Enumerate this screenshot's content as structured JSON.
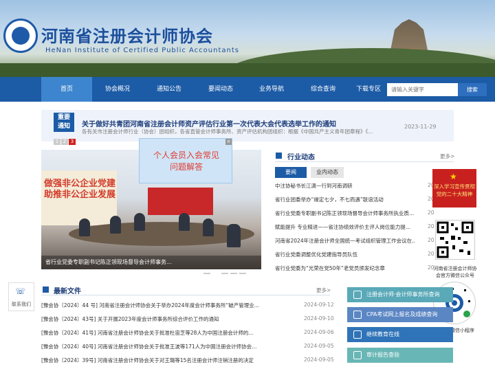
{
  "header": {
    "title": "河南省注册会计师协会",
    "subtitle": "HeNan Institute of Certified Public Accountants"
  },
  "nav": {
    "items": [
      "首页",
      "协会概况",
      "通知公告",
      "要闻动态",
      "业务导航",
      "综合查询",
      "下载专区"
    ],
    "active_index": 0,
    "search_placeholder": "请输入关键字",
    "search_button": "搜索"
  },
  "notice": {
    "badge_line1": "重要",
    "badge_line2": "通知",
    "pages": [
      "1",
      "2",
      "3"
    ],
    "active_page": "3",
    "title": "关于做好共青团河南省注册会计师资产评估行业第一次代表大会代表选举工作的通知",
    "summary": "各有关市注册会计师行业（协会）团组织，各省直管会计师事务所、资产评估机构团组织：根据《中国共产主义青年团章程》《...",
    "date": "2023-11-29"
  },
  "slideshow": {
    "caption": "省行业党委专职副书记陈正领现场督导会计师事务...",
    "wall_text_line1": "做强非公企业党建",
    "wall_text_line2": "助推非公企业发展"
  },
  "popup": {
    "line1": "个人会员入会常见",
    "line2": "问题解答",
    "close": "×"
  },
  "industry_news": {
    "title": "行业动态",
    "more": "更多>",
    "tabs": [
      "要闻",
      "业内动态"
    ],
    "items": [
      {
        "text": "中注协秘书长江潇一行到河南调研",
        "date": "20"
      },
      {
        "text": "省行业团委举办“缘定七夕，不七而遇”联谊活动",
        "date": "20"
      },
      {
        "text": "省行业党委专职副书记陈正领现场督导会计师事务所执业质...",
        "date": "20"
      },
      {
        "text": "赋能提升 专业精进——省注协绩效评价主评人岗位能力提...",
        "date": "20"
      },
      {
        "text": "河南省2024年注册会计师全国统一考试组织管理工作会议在...",
        "date": "20"
      },
      {
        "text": "省行业党委调整优化党建指导员队伍",
        "date": "20"
      },
      {
        "text": "省行业党委为“光荣在党50年”老党员颁发纪念章",
        "date": "20"
      }
    ]
  },
  "side_ad": {
    "line1": "深入学习宣传贯彻",
    "line2": "党的二十大精神"
  },
  "qr_codes": [
    {
      "caption_line1": "河南省注册会计师协",
      "caption_line2": "会官方微信公众号"
    },
    {
      "caption_line1": "中注协微信小程序",
      "caption_line2": ""
    }
  ],
  "contact": {
    "label": "联系我们"
  },
  "documents": {
    "title": "最新文件",
    "more": "更多>",
    "items": [
      {
        "text": "[豫会协〔2024〕44 号] 河南省注册会计师协会关于举办2024年度会计师事务所“破产管理业...",
        "date": "2024-09-12"
      },
      {
        "text": "[豫会协〔2024〕43号] 关于开展2023年度会计师事务所综合评价工作的通知",
        "date": "2024-09-10"
      },
      {
        "text": "[豫会协〔2024〕41号] 河南省注册会计师协会关于批准杜宙芝等28人为中国注册会计师的...",
        "date": "2024-09-06"
      },
      {
        "text": "[豫会协〔2024〕40号] 河南省注册会计师协会关于批准王波等171人为中国注册会计师协会...",
        "date": "2024-09-05"
      },
      {
        "text": "[豫会协〔2024〕39号] 河南省注册会计师协会关于对王璐等15名注册会计师注销注册的决定",
        "date": "2024-09-05"
      }
    ]
  },
  "services": {
    "items": [
      {
        "label": "注册会计师·会计师事务所查询",
        "color": "#5aa9b8"
      },
      {
        "label": "CPA考试网上报名及成绩查询",
        "color": "#5b86c4"
      },
      {
        "label": "继续教育在线",
        "color": "#2f73b8"
      },
      {
        "label": "审计报告查验",
        "color": "#68b7b6"
      }
    ]
  }
}
